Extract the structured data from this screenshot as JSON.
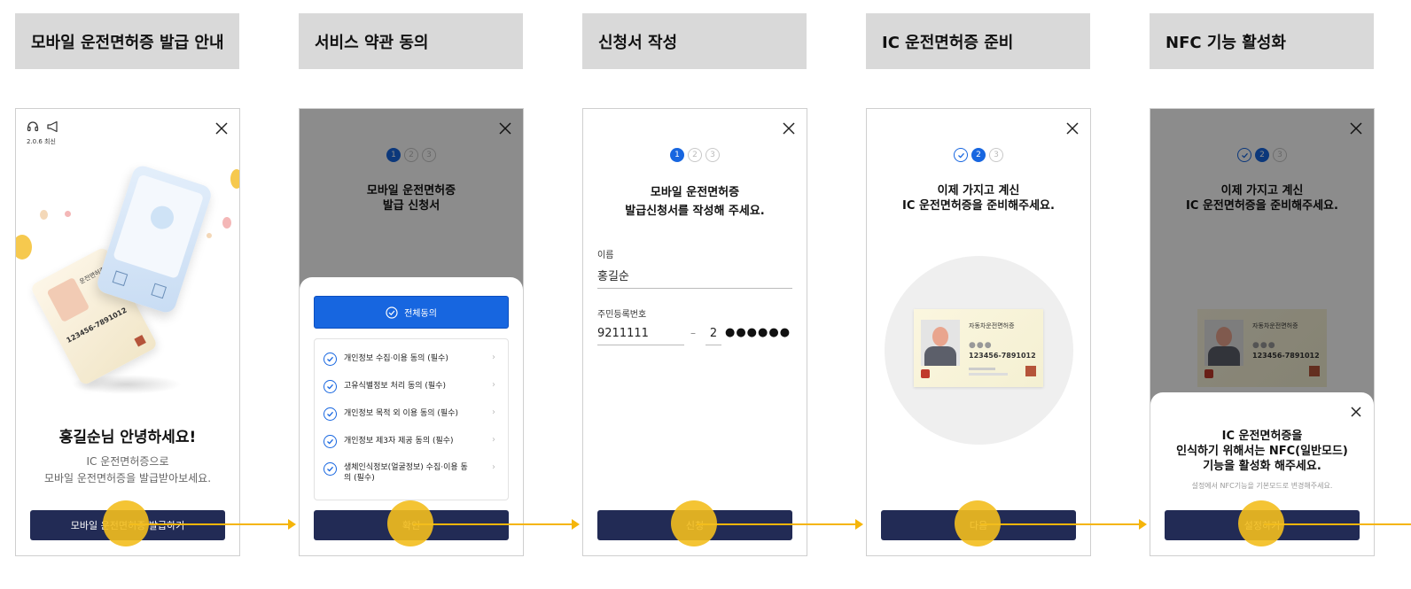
{
  "flow": {
    "headers": [
      "모바일 운전면허증 발급 안내",
      "서비스 약관 동의",
      "신청서 작성",
      "IC 운전면허증 준비",
      "NFC 기능 활성화"
    ]
  },
  "screen1": {
    "version": "2.0.6 최신",
    "card_title": "운전면허증",
    "card_number": "123456-7891012",
    "greeting": "홍길순님 안녕하세요!",
    "sub_line1": "IC 운전면허증으로",
    "sub_line2": "모바일 운전면허증을 발급받아보세요.",
    "button": "모바일 운전면허증 발급하기"
  },
  "screen2": {
    "steps": [
      "1",
      "2",
      "3"
    ],
    "title_line1": "모바일 운전면허증",
    "title_line2": "발급 신청서",
    "agree_all": "전체동의",
    "items": [
      "개인정보 수집·이용 동의 (필수)",
      "고유식별정보 처리 동의 (필수)",
      "개인정보 목적 외 이용 동의 (필수)",
      "개인정보 제3자 제공 동의 (필수)",
      "생체인식정보(얼굴정보) 수집·이용 동의 (필수)"
    ],
    "button": "확인"
  },
  "screen3": {
    "steps": [
      "1",
      "2",
      "3"
    ],
    "title_line1": "모바일 운전면허증",
    "title_line2": "발급신청서를 작성해 주세요.",
    "name_label": "이름",
    "name_value": "홍길순",
    "rrn_label": "주민등록번호",
    "rrn_front": "9211111",
    "rrn_dash": "–",
    "rrn_back_first": "2",
    "rrn_mask": "●●●●●●",
    "button": "신청"
  },
  "screen4": {
    "steps": [
      "2",
      "3"
    ],
    "title_line1": "이제 가지고 계신",
    "title_line2": "IC 운전면허증을 준비해주세요.",
    "card_title": "자동차운전면허증",
    "card_number": "123456-7891012",
    "button": "다음"
  },
  "screen5": {
    "steps": [
      "2",
      "3"
    ],
    "title_line1": "이제 가지고 계신",
    "title_line2": "IC 운전면허증을 준비해주세요.",
    "card_title": "자동차운전면허증",
    "card_number": "123456-7891012",
    "sheet_line1": "IC 운전면허증을",
    "sheet_line2": "인식하기 위해서는 NFC(일반모드)",
    "sheet_line3": "기능을 활성화 해주세요.",
    "sheet_hint": "설정에서 NFC기능을 기본모드로 변경해주세요.",
    "button": "설정하기"
  },
  "colors": {
    "primary_button": "#222b55",
    "accent_blue": "#1766e0",
    "tap_indicator": "#f3be1e",
    "header_bg": "#d9d9d9"
  }
}
